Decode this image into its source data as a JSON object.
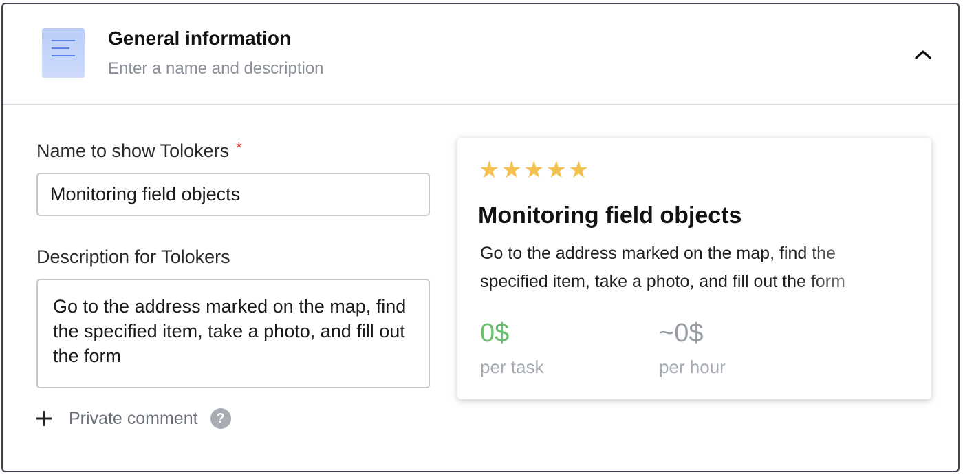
{
  "section": {
    "title": "General information",
    "subtitle": "Enter a name and description",
    "icon": "document-icon",
    "collapse_icon": "chevron-up-icon"
  },
  "form": {
    "name_label": "Name to show Tolokers",
    "name_required": "*",
    "name_value": "Monitoring field objects",
    "description_label": "Description for Tolokers",
    "description_value": "Go to the address marked on the map, find the specified item, take a photo, and fill out the form",
    "private_comment_label": "Private comment",
    "help_glyph": "?"
  },
  "preview": {
    "rating_stars": 5,
    "title": "Monitoring field objects",
    "description": "Go to the address marked on the map, find the specified item, take a photo, and fill out the form",
    "price_task": "0$",
    "price_task_label": "per task",
    "price_hour": "~0$",
    "price_hour_label": "per hour"
  },
  "colors": {
    "accent_star": "#f2c14e",
    "price_green": "#6bbf6e",
    "required_red": "#e5322d",
    "icon_blue": "#c4d4fb"
  }
}
